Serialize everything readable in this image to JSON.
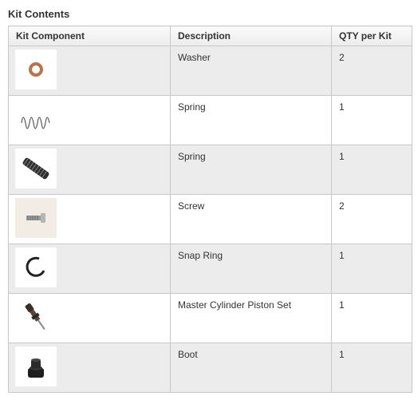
{
  "title": "Kit Contents",
  "columns": [
    "Kit Component",
    "Description",
    "QTY per Kit"
  ],
  "rows": [
    {
      "icon": "washer-icon",
      "description": "Washer",
      "qty": "2"
    },
    {
      "icon": "spring-icon",
      "description": "Spring",
      "qty": "1"
    },
    {
      "icon": "spring-icon",
      "description": "Spring",
      "qty": "1"
    },
    {
      "icon": "screw-icon",
      "description": "Screw",
      "qty": "2"
    },
    {
      "icon": "snap-ring-icon",
      "description": "Snap Ring",
      "qty": "1"
    },
    {
      "icon": "piston-set-icon",
      "description": "Master Cylinder Piston Set",
      "qty": "1"
    },
    {
      "icon": "boot-icon",
      "description": "Boot",
      "qty": "1"
    }
  ]
}
